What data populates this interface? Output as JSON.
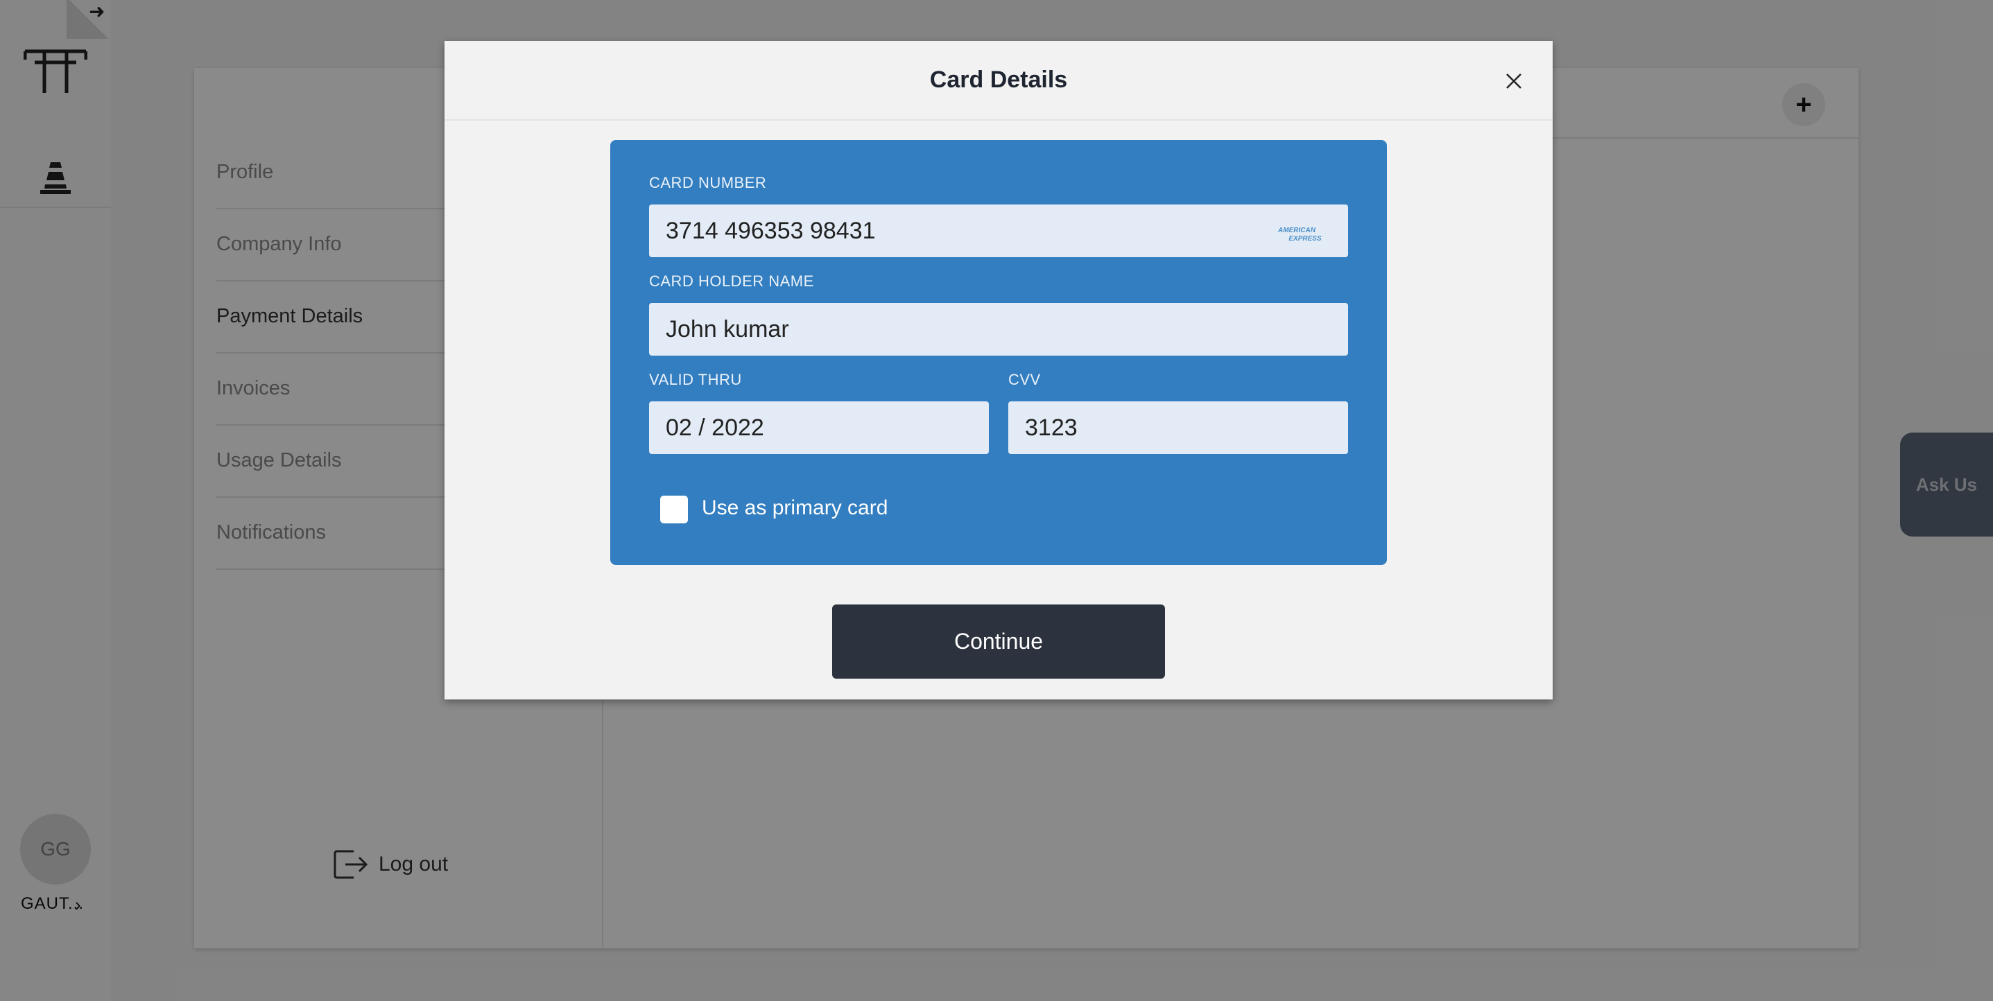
{
  "rail": {
    "user_initials": "GG",
    "user_name": "GAUT...",
    "user_chevron": "›"
  },
  "settings": {
    "nav_items": [
      {
        "label": "Profile",
        "active": false
      },
      {
        "label": "Company Info",
        "active": false
      },
      {
        "label": "Payment Details",
        "active": true
      },
      {
        "label": "Invoices",
        "active": false
      },
      {
        "label": "Usage Details",
        "active": false
      },
      {
        "label": "Notifications",
        "active": false
      }
    ],
    "logout_label": "Log out",
    "add_button_label": "+"
  },
  "ask_us": {
    "label": "Ask Us"
  },
  "modal": {
    "title": "Card Details",
    "card_number_label": "CARD NUMBER",
    "card_number_value": "3714 496353 98431",
    "card_brand": "AMERICAN EXPRESS",
    "holder_label": "CARD HOLDER NAME",
    "holder_value": "John kumar",
    "valid_thru_label": "VALID THRU",
    "valid_thru_value": "02 / 2022",
    "cvv_label": "CVV",
    "cvv_value": "3123",
    "primary_checkbox_label": "Use as primary card",
    "primary_checked": false,
    "continue_label": "Continue"
  },
  "colors": {
    "card_panel": "#337ec0",
    "field_bg": "#e3ecf6",
    "continue_bg": "#2c333e",
    "ask_us_bg": "#5b6879"
  },
  "icons": {
    "rail_arrow": "arrow-right-icon",
    "logo": "logo-icon",
    "cone": "traffic-cone-icon",
    "logout": "logout-icon",
    "close": "close-icon"
  }
}
